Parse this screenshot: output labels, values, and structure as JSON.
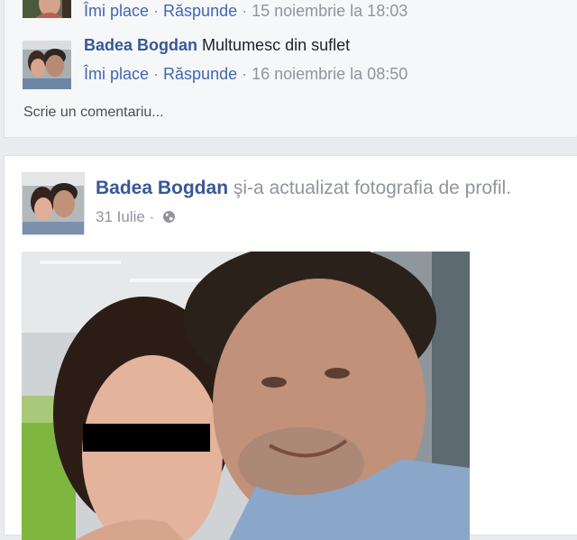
{
  "comments": [
    {
      "author": "",
      "text": "",
      "like_label": "Îmi place",
      "reply_label": "Răspunde",
      "separator": "·",
      "timestamp": "15 noiembrie la 18:03"
    },
    {
      "author": "Badea Bogdan",
      "text": "Multumesc din suflet",
      "like_label": "Îmi place",
      "reply_label": "Răspunde",
      "separator": "·",
      "timestamp": "16 noiembrie la 08:50"
    }
  ],
  "write_comment_placeholder": "Scrie un comentariu...",
  "post": {
    "author": "Badea Bogdan",
    "action_text": " şi-a actualizat fotografia de profil.",
    "date": "31 Iulie",
    "separator": "·",
    "privacy_icon": "globe-icon"
  },
  "colors": {
    "link": "#4267b2",
    "author": "#365899",
    "meta": "#90949c",
    "background": "#e9ebee"
  }
}
